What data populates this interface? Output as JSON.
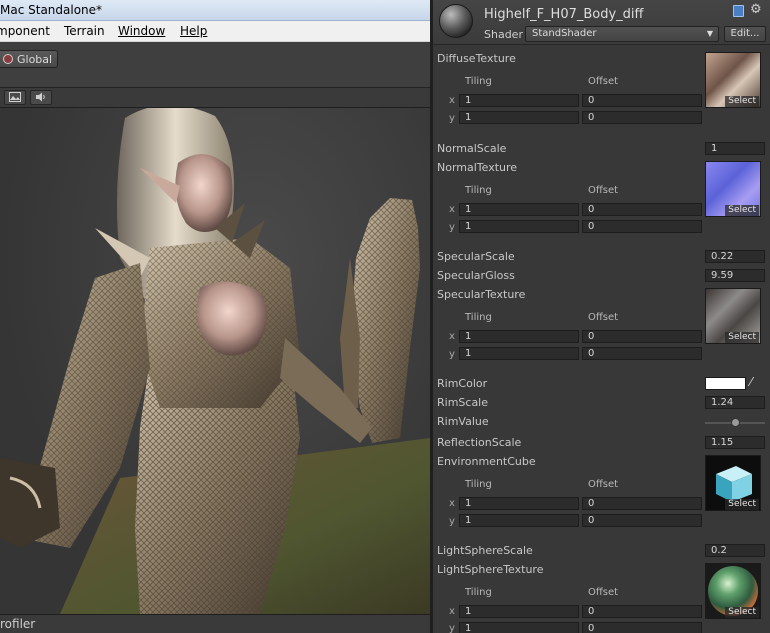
{
  "window": {
    "title": "Mac Standalone*"
  },
  "menu": [
    "mponent",
    "Terrain",
    "Window",
    "Help"
  ],
  "toolbar": {
    "global_label": "Global"
  },
  "profiler_label": "rofiler",
  "inspector": {
    "material_name": "Highelf_F_H07_Body_diff",
    "shader_label": "Shader",
    "shader_value": "StandShader",
    "edit_label": "Edit...",
    "tiling_label": "Tiling",
    "offset_label": "Offset",
    "x_label": "x",
    "y_label": "y",
    "select_label": "Select",
    "props": {
      "diffuse_texture": {
        "label": "DiffuseTexture",
        "tile_x": "1",
        "tile_y": "1",
        "off_x": "0",
        "off_y": "0"
      },
      "normal_scale": {
        "label": "NormalScale",
        "value": "1"
      },
      "normal_texture": {
        "label": "NormalTexture",
        "tile_x": "1",
        "tile_y": "1",
        "off_x": "0",
        "off_y": "0"
      },
      "specular_scale": {
        "label": "SpecularScale",
        "value": "0.22"
      },
      "specular_gloss": {
        "label": "SpecularGloss",
        "value": "9.59"
      },
      "specular_texture": {
        "label": "SpecularTexture",
        "tile_x": "1",
        "tile_y": "1",
        "off_x": "0",
        "off_y": "0"
      },
      "rim_color": {
        "label": "RimColor",
        "color": "#ffffff"
      },
      "rim_scale": {
        "label": "RimScale",
        "value": "1.24"
      },
      "rim_value": {
        "label": "RimValue",
        "slider_fraction": 0.5
      },
      "reflection_scale": {
        "label": "ReflectionScale",
        "value": "1.15"
      },
      "environment_cube": {
        "label": "EnvironmentCube",
        "tile_x": "1",
        "tile_y": "1",
        "off_x": "0",
        "off_y": "0"
      },
      "light_sphere_scale": {
        "label": "LightSphereScale",
        "value": "0.2"
      },
      "light_sphere_texture": {
        "label": "LightSphereTexture",
        "tile_x": "1",
        "tile_y": "1",
        "off_x": "0",
        "off_y": "0"
      }
    }
  },
  "icons": {
    "global": "pivot-circle-icon",
    "scene_image": "image-icon",
    "scene_audio": "speaker-icon",
    "help": "book-icon",
    "settings": "gear-icon",
    "color_picker": "eyedropper-icon"
  }
}
